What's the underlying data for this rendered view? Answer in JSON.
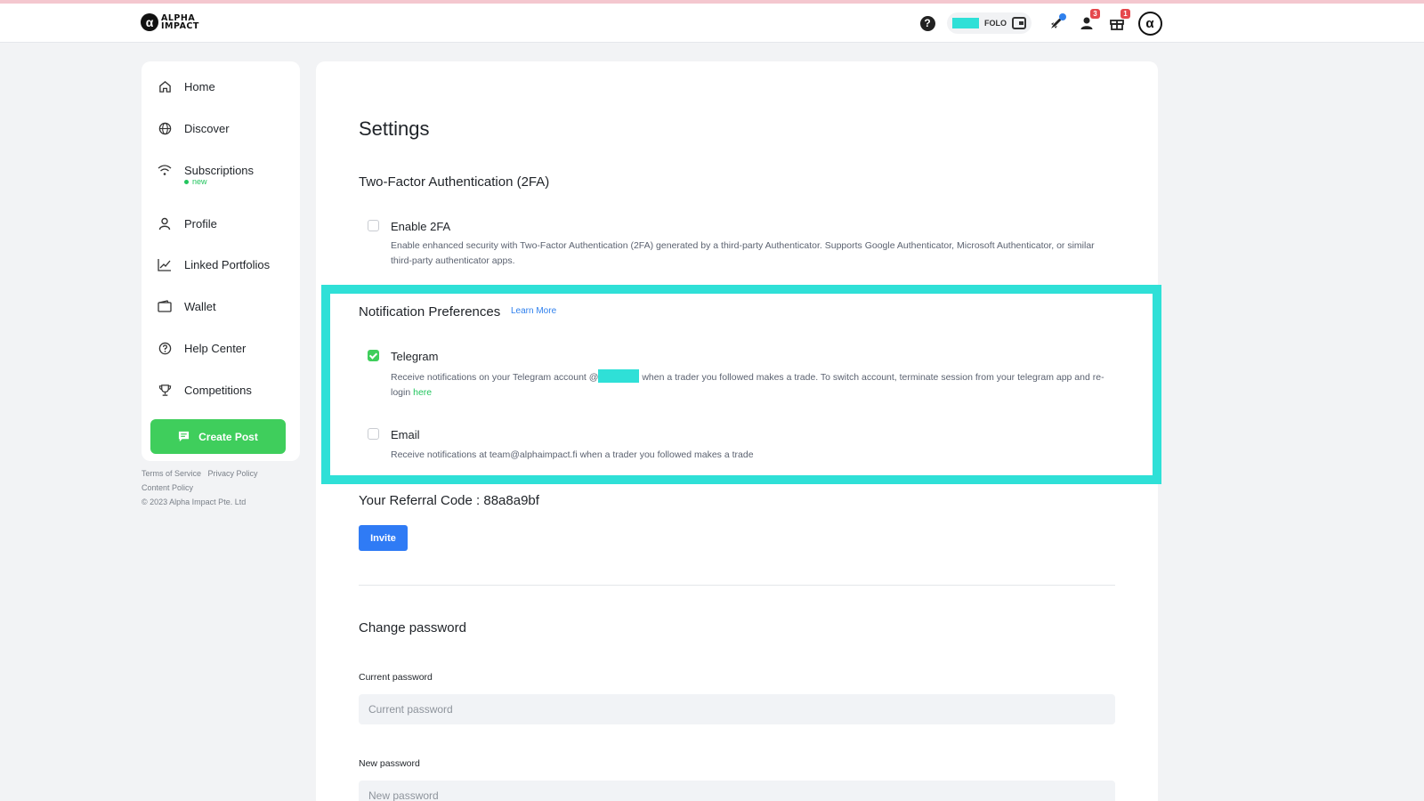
{
  "header": {
    "logo_mark": "α",
    "logo_line1": "ALPHA",
    "logo_line2": "IMPACT",
    "help_symbol": "?",
    "token_label": "FOLO",
    "notif_badge": "3",
    "gift_badge": "1",
    "avatar_symbol": "α",
    "highlight_color": "#2fe0d7"
  },
  "sidebar": {
    "items": [
      {
        "label": "Home",
        "icon": "home-icon"
      },
      {
        "label": "Discover",
        "icon": "globe-icon"
      },
      {
        "label": "Subscriptions",
        "icon": "wifi-icon",
        "tag": "new"
      },
      {
        "label": "Profile",
        "icon": "user-icon"
      },
      {
        "label": "Linked Portfolios",
        "icon": "chart-icon"
      },
      {
        "label": "Wallet",
        "icon": "wallet-icon"
      },
      {
        "label": "Help Center",
        "icon": "help-circle-icon"
      },
      {
        "label": "Competitions",
        "icon": "trophy-icon"
      }
    ],
    "create_post": "Create Post",
    "accent": "#3fce5c"
  },
  "footer": {
    "terms": "Terms of Service",
    "privacy": "Privacy Policy",
    "content": "Content Policy",
    "copyright": "© 2023 Alpha Impact Pte. Ltd"
  },
  "settings": {
    "title": "Settings",
    "twofa": {
      "title": "Two-Factor Authentication (2FA)",
      "option_label": "Enable 2FA",
      "checked": false,
      "description": "Enable enhanced security with Two-Factor Authentication (2FA) generated by a third-party Authenticator. Supports Google Authenticator, Microsoft Authenticator, or similar third-party authenticator apps."
    },
    "notifications": {
      "title": "Notification Preferences",
      "learn_more": "Learn More",
      "telegram": {
        "label": "Telegram",
        "checked": true,
        "desc_before": "Receive notifications on your Telegram account @",
        "desc_after": " when a trader you followed makes a trade. To switch account, terminate session from your telegram app and re-login ",
        "link": "here"
      },
      "email": {
        "label": "Email",
        "checked": false,
        "description": "Receive notifications at team@alphaimpact.fi when a trader you followed makes a trade"
      }
    },
    "referral": {
      "text": "Your Referral Code : 88a8a9bf",
      "invite": "Invite"
    },
    "password": {
      "title": "Change password",
      "current_label": "Current password",
      "current_placeholder": "Current password",
      "new_label": "New password",
      "new_placeholder": "New password"
    }
  }
}
